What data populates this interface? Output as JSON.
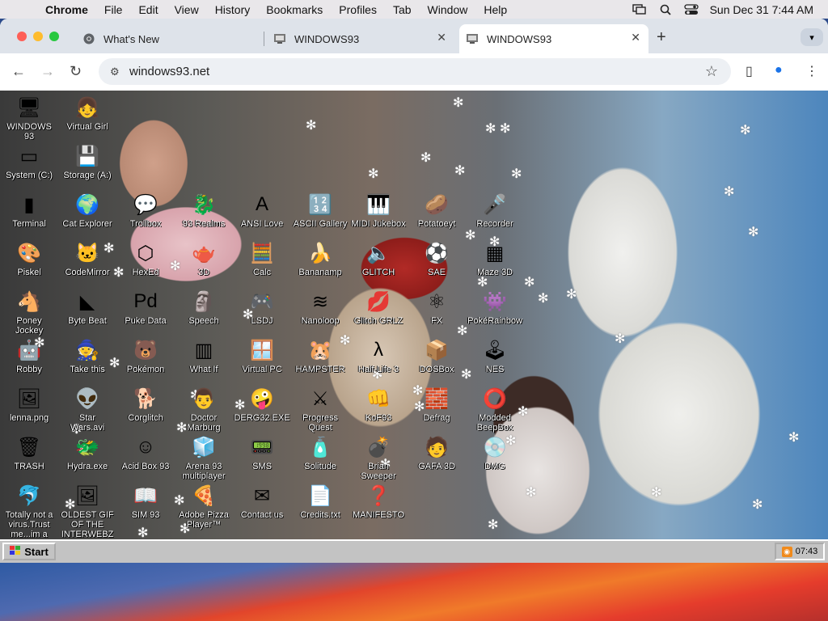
{
  "menubar": {
    "items": [
      "Chrome",
      "File",
      "Edit",
      "View",
      "History",
      "Bookmarks",
      "Profiles",
      "Tab",
      "Window",
      "Help"
    ],
    "datetime": "Sun Dec 31  7:44 AM"
  },
  "tabs": [
    {
      "title": "What's New"
    },
    {
      "title": "WINDOWS93"
    },
    {
      "title": "WINDOWS93"
    }
  ],
  "address": {
    "url": "windows93.net"
  },
  "desktop_icons": [
    {
      "label": "WINDOWS 93",
      "icon": "computer-icon",
      "glyph": "🖥"
    },
    {
      "label": "Virtual Girl",
      "icon": "girl-icon",
      "glyph": "👧"
    },
    {
      "label": "System (C:)",
      "icon": "drive-icon",
      "glyph": "▭"
    },
    {
      "label": "Storage (A:)",
      "icon": "floppy-drive-icon",
      "glyph": "💾"
    },
    {
      "label": "Terminal",
      "icon": "terminal-icon",
      "glyph": "▮"
    },
    {
      "label": "Cat Explorer",
      "icon": "cat-globe-icon",
      "glyph": "🌍"
    },
    {
      "label": "Trollbox",
      "icon": "trollbox-icon",
      "glyph": "💬"
    },
    {
      "label": "93 Realms",
      "icon": "realms-icon",
      "glyph": "🐉"
    },
    {
      "label": "ANSI Love",
      "icon": "ansi-icon",
      "glyph": "A"
    },
    {
      "label": "ASCII Gallery",
      "icon": "ascii-icon",
      "glyph": "🔢"
    },
    {
      "label": "MIDI Jukebox",
      "icon": "piano-icon",
      "glyph": "🎹"
    },
    {
      "label": "Potatoeyt",
      "icon": "potato-icon",
      "glyph": "🥔"
    },
    {
      "label": "Recorder",
      "icon": "microphone-icon",
      "glyph": "🎤"
    },
    {
      "label": "Piskel",
      "icon": "palette-icon",
      "glyph": "🎨"
    },
    {
      "label": "CodeMirror",
      "icon": "codemirror-icon",
      "glyph": "🐱"
    },
    {
      "label": "HexEd",
      "icon": "cube-icon",
      "glyph": "⬡"
    },
    {
      "label": "3D",
      "icon": "teapot-icon",
      "glyph": "🫖"
    },
    {
      "label": "Calc",
      "icon": "calculator-icon",
      "glyph": "🧮"
    },
    {
      "label": "Bananamp",
      "icon": "banana-icon",
      "glyph": "🍌"
    },
    {
      "label": "GLITCH",
      "icon": "speaker-icon",
      "glyph": "🔈"
    },
    {
      "label": "SAE",
      "icon": "ball-icon",
      "glyph": "⚽"
    },
    {
      "label": "Maze 3D",
      "icon": "maze-icon",
      "glyph": "▦"
    },
    {
      "label": "Poney\nJockey",
      "icon": "pony-icon",
      "glyph": "🐴"
    },
    {
      "label": "Byte Beat",
      "icon": "bytebeat-icon",
      "glyph": "◣"
    },
    {
      "label": "Puke Data",
      "icon": "pd-icon",
      "glyph": "Pd"
    },
    {
      "label": "Speech",
      "icon": "speech-face-icon",
      "glyph": "🗿"
    },
    {
      "label": "LSDJ",
      "icon": "lsdj-icon",
      "glyph": "🎮"
    },
    {
      "label": "Nanoloop",
      "icon": "nanoloop-icon",
      "glyph": "≋"
    },
    {
      "label": "Glitch GRLZ",
      "icon": "lips-icon",
      "glyph": "💋"
    },
    {
      "label": "FX",
      "icon": "atom-icon",
      "glyph": "⚛"
    },
    {
      "label": "PokéRainbow",
      "icon": "pokerainbow-icon",
      "glyph": "👾"
    },
    {
      "label": "Robby",
      "icon": "robot-icon",
      "glyph": "🤖"
    },
    {
      "label": "Take this",
      "icon": "takethis-icon",
      "glyph": "🧙"
    },
    {
      "label": "Pokémon",
      "icon": "pokemon-icon",
      "glyph": "🐻"
    },
    {
      "label": "What If",
      "icon": "whatif-icon",
      "glyph": "▥"
    },
    {
      "label": "Virtual PC",
      "icon": "virtualpc-icon",
      "glyph": "🪟"
    },
    {
      "label": "HAMPSTER",
      "icon": "hamster-icon",
      "glyph": "🐹"
    },
    {
      "label": "Half-Life 3",
      "icon": "lambda-icon",
      "glyph": "λ"
    },
    {
      "label": "DOSBox",
      "icon": "dosbox-icon",
      "glyph": "📦"
    },
    {
      "label": "NES",
      "icon": "nes-icon",
      "glyph": "🕹"
    },
    {
      "label": "lenna.png",
      "icon": "image-file-icon",
      "glyph": "🖼"
    },
    {
      "label": "Star\nWars.avi",
      "icon": "yoda-icon",
      "glyph": "👽"
    },
    {
      "label": "Corglitch",
      "icon": "corgi-icon",
      "glyph": "🐕"
    },
    {
      "label": "Doctor\nMarburg",
      "icon": "doctor-icon",
      "glyph": "👨"
    },
    {
      "label": "DERG32.EXE",
      "icon": "derg-icon",
      "glyph": "🤪"
    },
    {
      "label": "Progress\nQuest",
      "icon": "swords-icon",
      "glyph": "⚔"
    },
    {
      "label": "KoF93",
      "icon": "fighter-icon",
      "glyph": "👊"
    },
    {
      "label": "Defrag",
      "icon": "defrag-icon",
      "glyph": "🧱"
    },
    {
      "label": "Modded\nBeepBox",
      "icon": "beepbox-icon",
      "glyph": "⭕"
    },
    {
      "label": "TRASH",
      "icon": "trash-icon",
      "glyph": "🗑"
    },
    {
      "label": "Hydra.exe",
      "icon": "hydra-icon",
      "glyph": "🐲"
    },
    {
      "label": "Acid Box 93",
      "icon": "smiley-icon",
      "glyph": "☺"
    },
    {
      "label": "Arena 93\nmultiplayer",
      "icon": "arena-cube-icon",
      "glyph": "🧊"
    },
    {
      "label": "SMS",
      "icon": "sms-icon",
      "glyph": "📟"
    },
    {
      "label": "Solitude",
      "icon": "solitude-icon",
      "glyph": "🧴"
    },
    {
      "label": "Brian\nSweeper",
      "icon": "mine-icon",
      "glyph": "💣"
    },
    {
      "label": "GAFA 3D",
      "icon": "gafa-icon",
      "glyph": "🧑"
    },
    {
      "label": "DMG",
      "icon": "disk-image-icon",
      "glyph": "💿"
    },
    {
      "label": "Totally not a\nvirus.Trust\nme...im a",
      "icon": "dolphin-icon",
      "glyph": "🐬"
    },
    {
      "label": "OLDEST GIF\nOF THE\nINTERWEBZ",
      "icon": "gif-file-icon",
      "glyph": "🖼"
    },
    {
      "label": "SIM 93",
      "icon": "sim-icon",
      "glyph": "📖"
    },
    {
      "label": "Adobe Pizza\nPlayer™",
      "icon": "pizza-icon",
      "glyph": "🍕"
    },
    {
      "label": "Contact us",
      "icon": "contact-icon",
      "glyph": "✉"
    },
    {
      "label": "Credits.txt",
      "icon": "text-file-icon",
      "glyph": "📄"
    },
    {
      "label": "MANIFESTO",
      "icon": "question-icon",
      "glyph": "❓"
    }
  ],
  "taskbar": {
    "start_label": "Start",
    "clock": "07:43"
  }
}
